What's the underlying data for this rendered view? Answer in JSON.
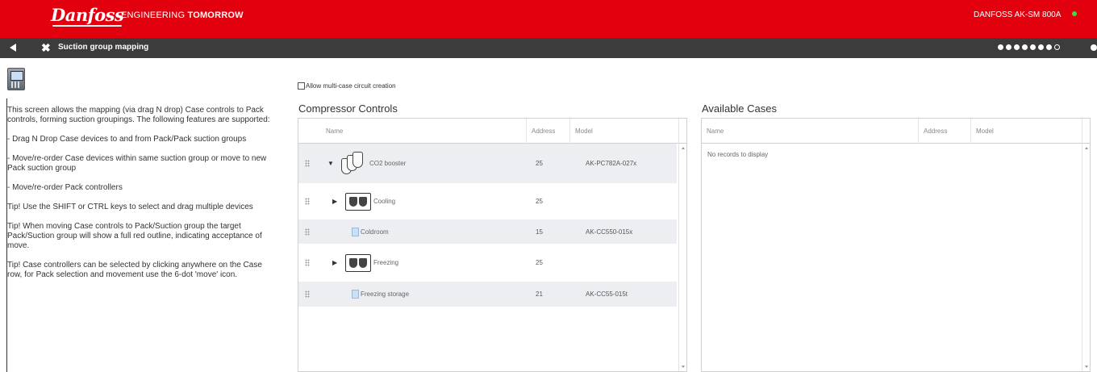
{
  "header": {
    "logo_text": "Danfoss",
    "tagline_regular": "ENGINEERING ",
    "tagline_bold": "TOMORROW",
    "device_name": "DANFOSS AK-SM 800A",
    "status_color": "#3cdc3c",
    "brand_color": "#e2000f"
  },
  "nav": {
    "back_icon": "arrow-left-icon",
    "close_icon": "close-x-icon",
    "close_glyph": "✖",
    "title": "Suction group mapping",
    "page_indicator": {
      "total": 8,
      "hollow_index": 7
    }
  },
  "help": {
    "paragraphs": [
      "This screen allows the mapping (via drag N drop) Case controls to Pack controls, forming suction groupings. The following features are supported:",
      "- Drag N Drop Case devices to and from Pack/Pack suction groups",
      "- Move/re-order Case devices within same suction group or move to new Pack suction group",
      "- Move/re-order Pack controllers",
      "Tip! Use the SHIFT or CTRL keys to select and drag multiple devices",
      "Tip! When moving Case controls to Pack/Suction group the target Pack/Suction group will show a full red outline, indicating acceptance of move.",
      "Tip! Case controllers can be selected by clicking anywhere on the Case row, for Pack selection and movement use the 6-dot 'move' icon."
    ]
  },
  "options": {
    "multicase_label": "Allow multi-case circuit creation",
    "multicase_checked": false
  },
  "compressor": {
    "title": "Compressor Controls",
    "columns": [
      "Name",
      "Address",
      "Model"
    ],
    "rows": [
      {
        "name": "CO2 booster",
        "address": "25",
        "model": "AK-PC782A-027x",
        "expander": "▼",
        "icon": "compressor-pack-icon"
      },
      {
        "name": "Cooling",
        "address": "25",
        "model": "",
        "expander": "▶",
        "icon": "suction-group-icon"
      },
      {
        "name": "Coldroom",
        "address": "15",
        "model": "AK-CC550-015x",
        "expander": "",
        "icon": "case-controller-icon"
      },
      {
        "name": "Freezing",
        "address": "25",
        "model": "",
        "expander": "▶",
        "icon": "suction-group-icon"
      },
      {
        "name": "Freezing storage",
        "address": "21",
        "model": "AK-CC55-015t",
        "expander": "",
        "icon": "case-controller-icon"
      }
    ]
  },
  "available": {
    "title": "Available Cases",
    "columns": [
      "Name",
      "Address",
      "Model"
    ],
    "empty_text": "No records to display"
  }
}
